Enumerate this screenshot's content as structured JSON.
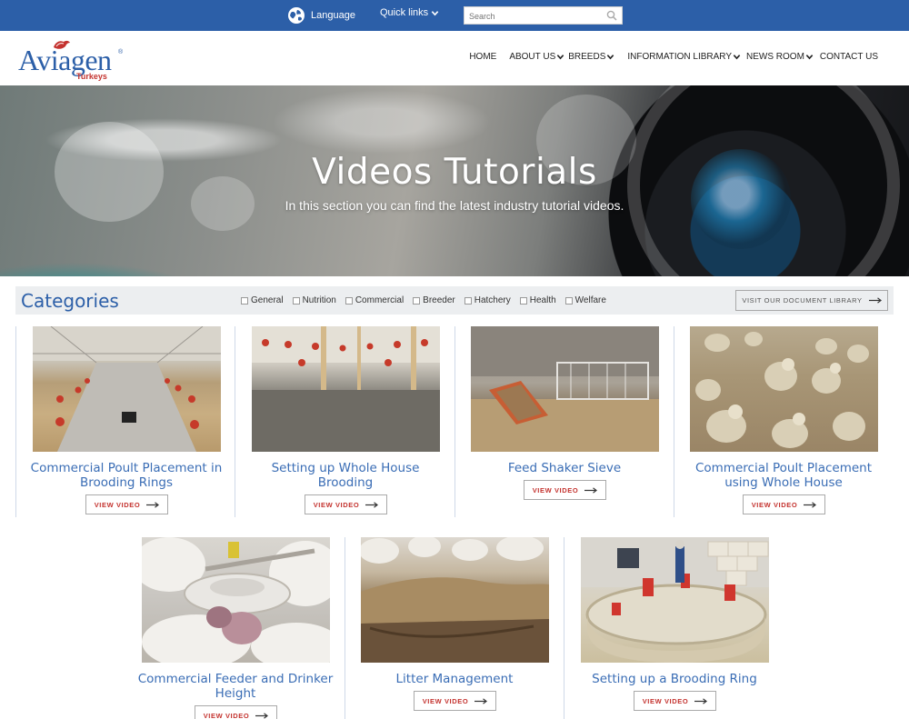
{
  "topbar": {
    "language_label": "Language",
    "quick_links_label": "Quick links",
    "search_placeholder": "Search"
  },
  "logo": {
    "brand": "Aviagen",
    "sub": "Turkeys",
    "reg": "®"
  },
  "nav": [
    {
      "label": "HOME",
      "dropdown": false
    },
    {
      "label": "ABOUT US",
      "dropdown": true
    },
    {
      "label": "BREEDS",
      "dropdown": true
    },
    {
      "label": "INFORMATION LIBRARY",
      "dropdown": true
    },
    {
      "label": "NEWS ROOM",
      "dropdown": true
    },
    {
      "label": "CONTACT US",
      "dropdown": false
    }
  ],
  "hero": {
    "title": "Videos Tutorials",
    "subtitle": "In this section you can find the latest industry tutorial videos."
  },
  "categories": {
    "title": "Categories",
    "filters": [
      "General",
      "Nutrition",
      "Commercial",
      "Breeder",
      "Hatchery",
      "Health",
      "Welfare"
    ],
    "doc_library_label": "VISIT OUR DOCUMENT LIBRARY"
  },
  "videos": [
    {
      "title": "Commercial Poult Placement in Brooding Rings",
      "button": "VIEW VIDEO"
    },
    {
      "title": "Setting up Whole House Brooding",
      "button": "VIEW VIDEO"
    },
    {
      "title": "Feed Shaker Sieve",
      "button": "VIEW VIDEO"
    },
    {
      "title": "Commercial Poult Placement using Whole House",
      "button": "VIEW VIDEO"
    },
    {
      "title": "Commercial Feeder and Drinker Height",
      "button": "VIEW VIDEO"
    },
    {
      "title": "Litter Management",
      "button": "VIEW VIDEO"
    },
    {
      "title": "Setting up a Brooding Ring",
      "button": "VIEW VIDEO"
    }
  ],
  "colors": {
    "brand_blue": "#2c5fa8",
    "accent_red": "#c4332f",
    "card_title": "#3a6db5"
  }
}
